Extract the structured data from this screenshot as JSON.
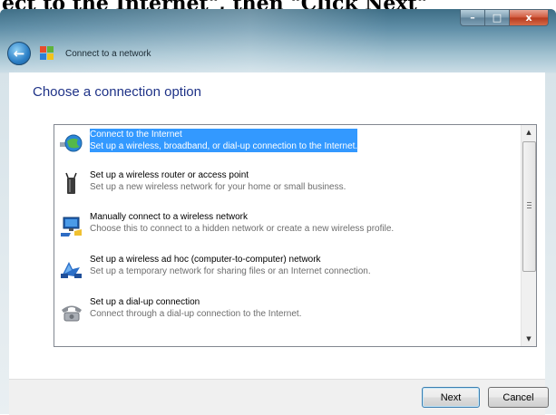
{
  "caption": {
    "text": "ect to the Internet\", then \"Click Next\""
  },
  "window": {
    "title": "Connect to a network",
    "controls": {
      "minimize": "–",
      "maximize": "□",
      "close": "x"
    }
  },
  "content": {
    "heading": "Choose a connection option",
    "options": [
      {
        "title": "Connect to the Internet",
        "description": "Set up a wireless, broadband, or dial-up connection to the Internet.",
        "icon": "globe-network-icon",
        "selected": true
      },
      {
        "title": "Set up a wireless router or access point",
        "description": "Set up a new wireless network for your home or small business.",
        "icon": "wireless-router-icon",
        "selected": false
      },
      {
        "title": "Manually connect to a wireless network",
        "description": "Choose this to connect to a hidden network or create a new wireless profile.",
        "icon": "wireless-network-icon",
        "selected": false
      },
      {
        "title": "Set up a wireless ad hoc (computer-to-computer) network",
        "description": "Set up a temporary network for sharing files or an Internet connection.",
        "icon": "ad-hoc-network-icon",
        "selected": false
      },
      {
        "title": "Set up a dial-up connection",
        "description": "Connect through a dial-up connection to the Internet.",
        "icon": "dial-up-phone-icon",
        "selected": false
      }
    ]
  },
  "footer": {
    "next_label": "Next",
    "cancel_label": "Cancel"
  },
  "colors": {
    "heading": "#1e3287",
    "selection": "#3399ff"
  }
}
